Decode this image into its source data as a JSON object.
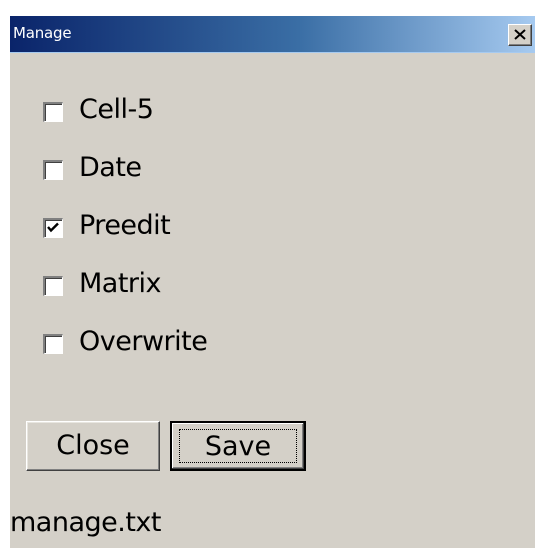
{
  "window": {
    "title": "Manage"
  },
  "options": [
    {
      "label": "Cell-5",
      "checked": false
    },
    {
      "label": "Date",
      "checked": false
    },
    {
      "label": "Preedit",
      "checked": true
    },
    {
      "label": "Matrix",
      "checked": false
    },
    {
      "label": "Overwrite",
      "checked": false
    }
  ],
  "buttons": {
    "close_label": "Close",
    "save_label": "Save"
  },
  "status": {
    "filename": "manage.txt"
  },
  "colors": {
    "titlebar_start": "#0a246a",
    "titlebar_end": "#a6caf0",
    "face": "#d4d0c8"
  },
  "icons": {
    "close": "close-x-icon",
    "check": "checkmark-icon"
  }
}
